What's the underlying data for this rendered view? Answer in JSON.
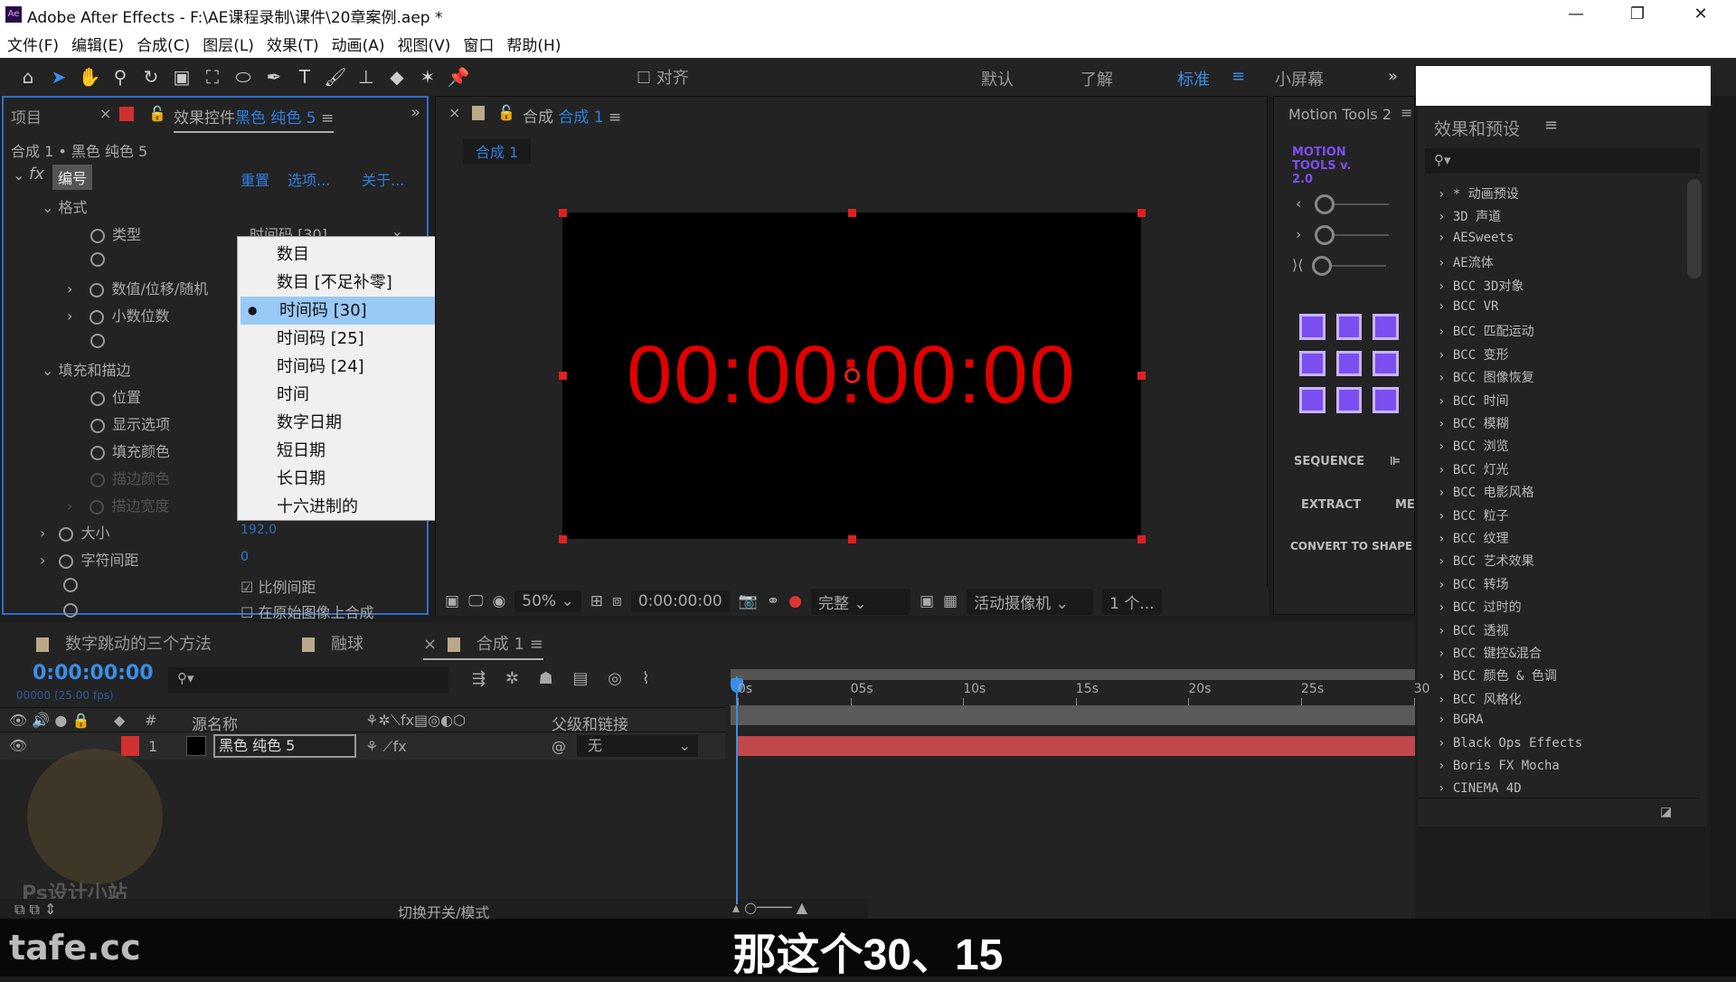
{
  "window": {
    "title": "Adobe After Effects - F:\\AE课程录制\\课件\\20章案例.aep *",
    "logo": "Ae",
    "controls": [
      "minimize",
      "restore",
      "close"
    ]
  },
  "menu": [
    "文件(F)",
    "编辑(E)",
    "合成(C)",
    "图层(L)",
    "效果(T)",
    "动画(A)",
    "视图(V)",
    "窗口",
    "帮助(H)"
  ],
  "toolbar": {
    "snap_label": "对齐",
    "workspaces": [
      "默认",
      "了解",
      "标准",
      "小屏幕"
    ],
    "active_workspace": "标准"
  },
  "effect_panel": {
    "tab_project": "项目",
    "tab_title": "效果控件",
    "tab_layer": "黑色 纯色 5",
    "breadcrumb": "合成 1 • 黑色 纯色 5",
    "effect_name": "编号",
    "reset": "重置",
    "options": "选项...",
    "about": "关于...",
    "props": {
      "format": "格式",
      "type": "类型",
      "type_value": "时间码 [30]",
      "value_offset": "数值/位移/随机",
      "decimals": "小数位数",
      "fill_stroke": "填充和描边",
      "position": "位置",
      "display": "显示选项",
      "fill_color": "填充颜色",
      "stroke_color": "描边颜色",
      "stroke_width": "描边宽度",
      "size": "大小",
      "size_value": "192.0",
      "tracking": "字符间距",
      "tracking_value": "0",
      "prop_spacing": "比例间距",
      "composite": "在原始图像上合成"
    }
  },
  "dropdown": {
    "items": [
      "数目",
      "数目 [不足补零]",
      "时间码 [30]",
      "时间码 [25]",
      "时间码 [24]",
      "时间",
      "数字日期",
      "短日期",
      "长日期",
      "十六进制的"
    ],
    "selected_index": 2
  },
  "viewer": {
    "tab_label": "合成",
    "comp_name": "合成 1",
    "sub_tab": "合成 1",
    "timecode_display": "00:00:00:00",
    "zoom": "50%",
    "current_time": "0:00:00:00",
    "resolution": "完整",
    "camera": "活动摄像机",
    "views": "1 个..."
  },
  "motion_tools": {
    "title": "Motion Tools 2",
    "logo": "MOTION TOOLS v. 2.0",
    "sequence": "SEQUENCE",
    "extract": "EXTRACT",
    "merge": "ME",
    "convert": "CONVERT TO SHAPE",
    "accent": "#7b4ff0"
  },
  "presets": {
    "title": "效果和预设",
    "items": [
      "* 动画预设",
      "3D 声道",
      "AESweets",
      "AE流体",
      "BCC 3D对象",
      "BCC VR",
      "BCC 匹配运动",
      "BCC 变形",
      "BCC 图像恢复",
      "BCC 时间",
      "BCC 模糊",
      "BCC 浏览",
      "BCC 灯光",
      "BCC 电影风格",
      "BCC 粒子",
      "BCC 纹理",
      "BCC 艺术效果",
      "BCC 转场",
      "BCC 过时的",
      "BCC 透视",
      "BCC 键控&混合",
      "BCC 颜色 & 色调",
      "BCC 风格化",
      "BGRA",
      "Black Ops Effects",
      "Boris FX Mocha",
      "CINEMA 4D"
    ]
  },
  "timeline": {
    "tabs": [
      "数字跳动的三个方法",
      "融球",
      "合成 1"
    ],
    "timecode": "0:00:00:00",
    "frame_info": "00000 (25.00 fps)",
    "col_source": "源名称",
    "col_parent": "父级和链接",
    "col_num": "#",
    "layer": {
      "num": "1",
      "name": "黑色 纯色 5",
      "parent": "无"
    },
    "ruler": [
      "0s",
      "05s",
      "10s",
      "15s",
      "20s",
      "25s",
      "30"
    ],
    "toggle_label": "切换开关/模式",
    "layer_color": "#c0474a"
  },
  "subtitle": "那这个30、15",
  "watermark": {
    "brand": "tafe.cc",
    "logo_text": "Ps设计小站"
  }
}
